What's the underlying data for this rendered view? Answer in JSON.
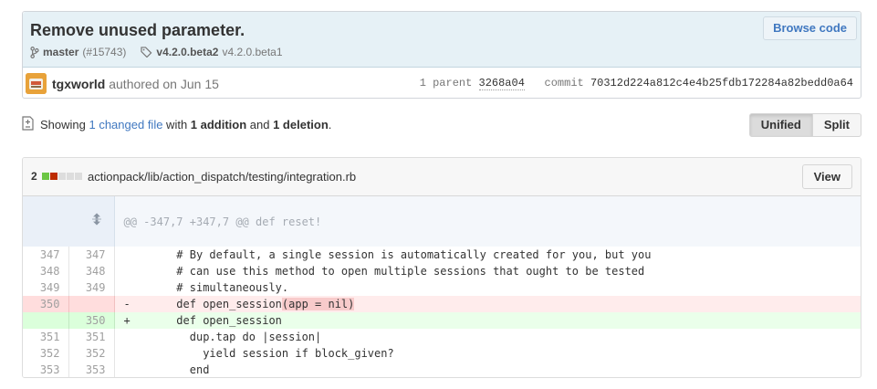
{
  "commit": {
    "title": "Remove unused parameter.",
    "browse_label": "Browse code",
    "branch": "master",
    "pr": "(#15743)",
    "tag_main": "v4.2.0.beta2",
    "tag_other": "v4.2.0.beta1",
    "author": "tgxworld",
    "authored": "authored on Jun 15",
    "parent_label": "1 parent",
    "parent_sha": "3268a04",
    "commit_label": "commit",
    "commit_sha": "70312d224a812c4e4b25fdb172284a82bedd0a64"
  },
  "toc": {
    "showing": "Showing ",
    "changed": "1 changed file",
    "with": " with ",
    "additions": "1 addition",
    "and": " and ",
    "deletions": "1 deletion",
    "period": ".",
    "unified_label": "Unified",
    "split_label": "Split"
  },
  "file": {
    "changes": "2",
    "path": "actionpack/lib/action_dispatch/testing/integration.rb",
    "view_label": "View",
    "hunk": "@@ -347,7 +347,7 @@ def reset!",
    "lines": [
      {
        "type": "ctx",
        "old": "347",
        "new": "347",
        "code": "        # By default, a single session is automatically created for you, but you"
      },
      {
        "type": "ctx",
        "old": "348",
        "new": "348",
        "code": "        # can use this method to open multiple sessions that ought to be tested"
      },
      {
        "type": "ctx",
        "old": "349",
        "new": "349",
        "code": "        # simultaneously."
      },
      {
        "type": "del",
        "old": "350",
        "new": "",
        "code_pre": "-       def open_session",
        "code_hl": "(app = nil)"
      },
      {
        "type": "add",
        "old": "",
        "new": "350",
        "code": "+       def open_session"
      },
      {
        "type": "ctx",
        "old": "351",
        "new": "351",
        "code": "          dup.tap do |session|"
      },
      {
        "type": "ctx",
        "old": "352",
        "new": "352",
        "code": "            yield session if block_given?"
      },
      {
        "type": "ctx",
        "old": "353",
        "new": "353",
        "code": "          end"
      }
    ]
  },
  "colors": {
    "link": "#4078c0",
    "del_bg": "#ffecec",
    "add_bg": "#eaffea",
    "diffstat_add": "#6cc644",
    "diffstat_del": "#bd2c00"
  }
}
